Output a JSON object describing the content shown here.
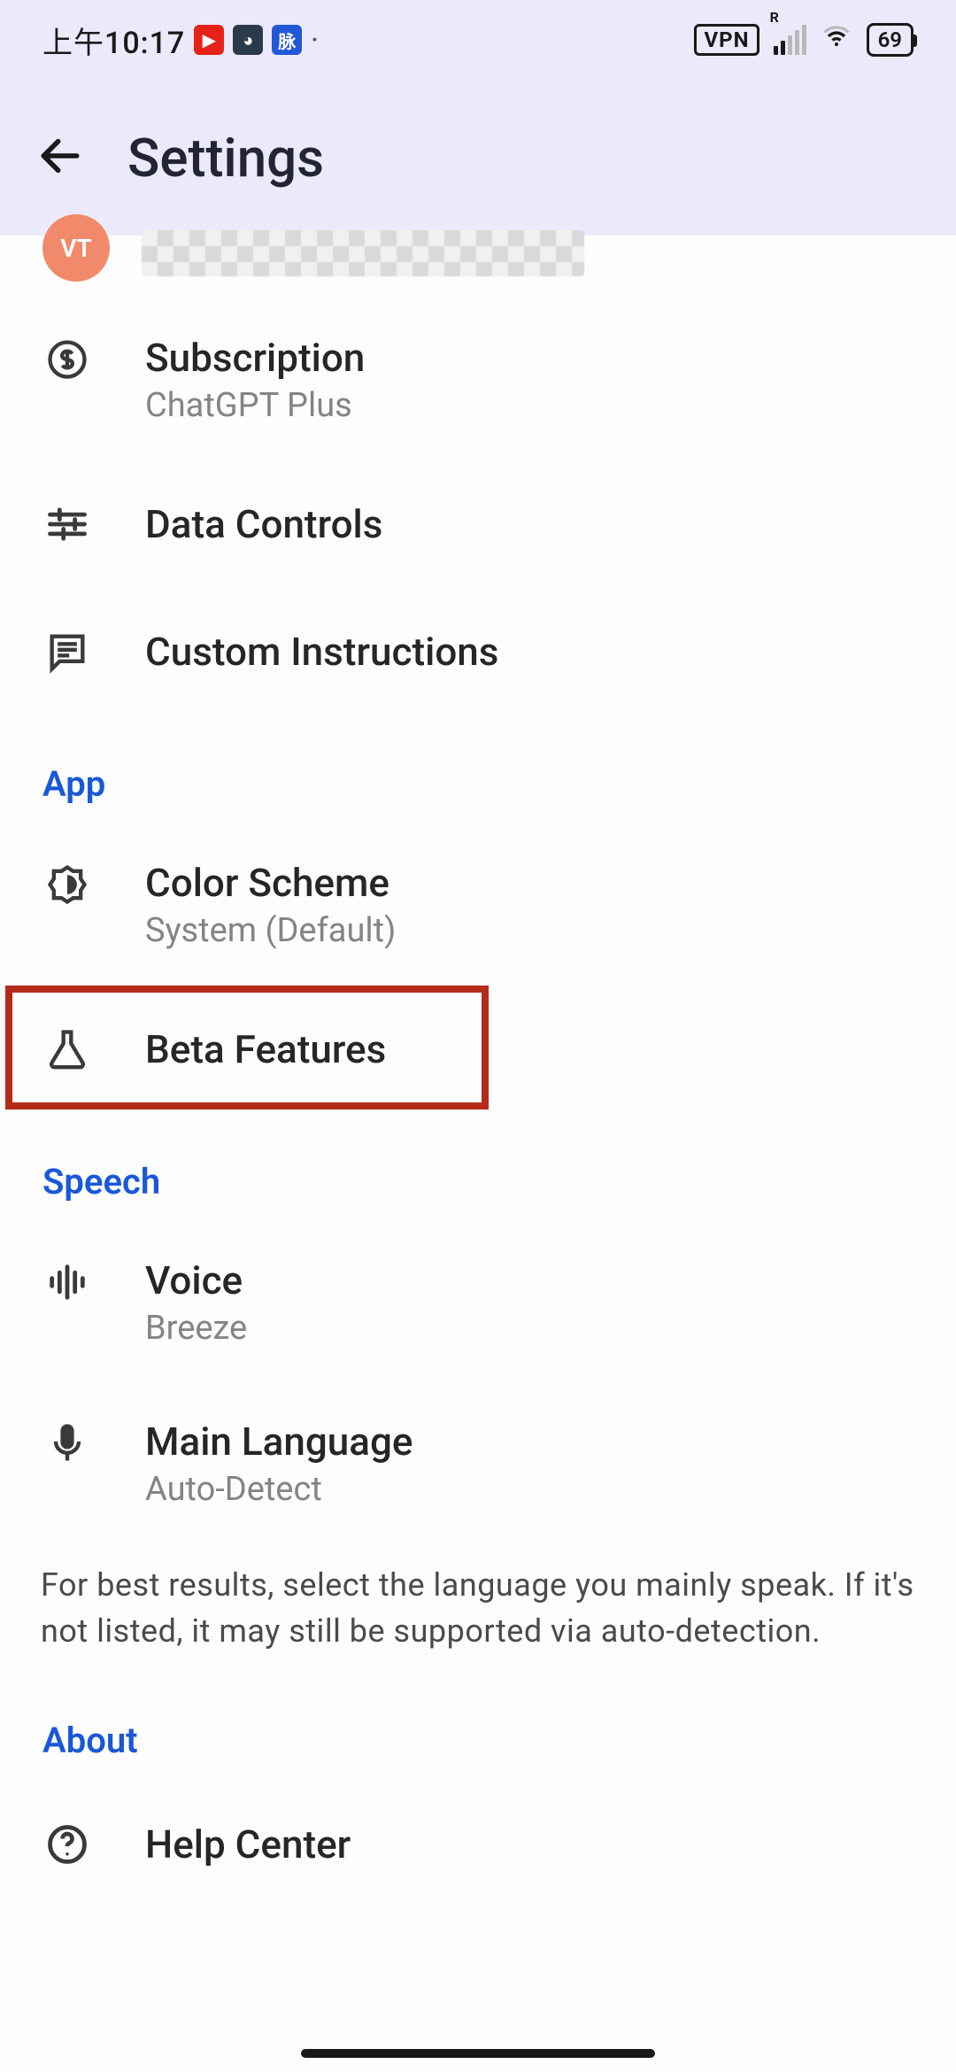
{
  "status_bar": {
    "time": "上午10:17",
    "vpn": "VPN",
    "signal_label": "R",
    "battery": "69",
    "mai_icon_text": "脉"
  },
  "header": {
    "title": "Settings"
  },
  "account": {
    "avatar_initials": "VT"
  },
  "items": {
    "subscription": {
      "title": "Subscription",
      "sub": "ChatGPT Plus"
    },
    "data_controls": {
      "title": "Data Controls"
    },
    "custom_instructions": {
      "title": "Custom Instructions"
    },
    "color_scheme": {
      "title": "Color Scheme",
      "sub": "System (Default)"
    },
    "beta_features": {
      "title": "Beta Features"
    },
    "voice": {
      "title": "Voice",
      "sub": "Breeze"
    },
    "main_language": {
      "title": "Main Language",
      "sub": "Auto-Detect"
    },
    "help_center": {
      "title": "Help Center"
    }
  },
  "sections": {
    "app": "App",
    "speech": "Speech",
    "about": "About"
  },
  "speech_note": "For best results, select the language you mainly speak. If it's not listed, it may still be supported via auto-detection."
}
